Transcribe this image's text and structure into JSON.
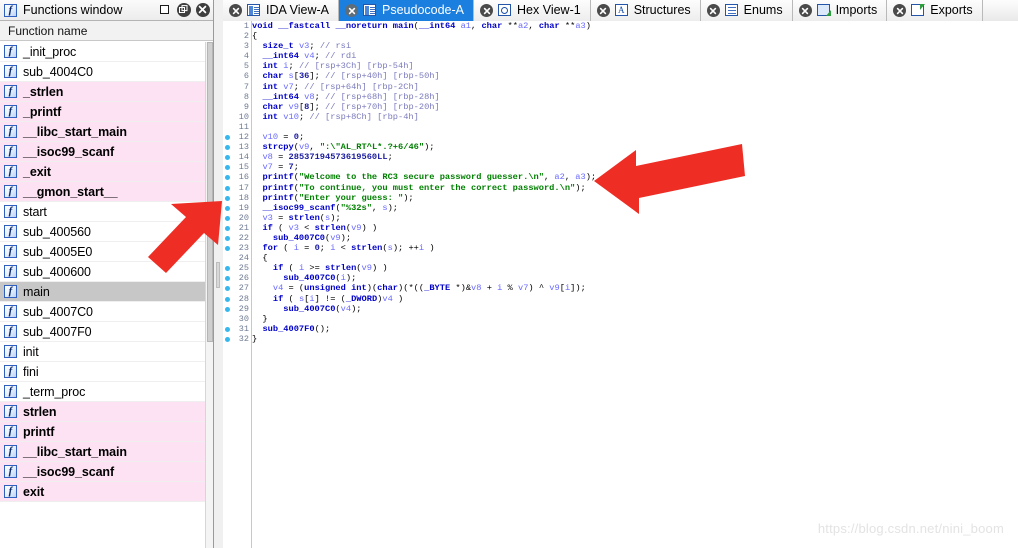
{
  "functions_window": {
    "title": "Functions window",
    "title_icon": "function-f-icon",
    "buttons": {
      "restore_label": "restore-window",
      "float_label": "float-window",
      "close_label": "close-window"
    },
    "column_header": "Function name",
    "rows": [
      {
        "name": "_init_proc",
        "style": "normal"
      },
      {
        "name": "sub_4004C0",
        "style": "normal"
      },
      {
        "name": "_strlen",
        "style": "pink"
      },
      {
        "name": "_printf",
        "style": "pink"
      },
      {
        "name": "__libc_start_main",
        "style": "pink"
      },
      {
        "name": "__isoc99_scanf",
        "style": "pink"
      },
      {
        "name": "_exit",
        "style": "pink"
      },
      {
        "name": "__gmon_start__",
        "style": "pink"
      },
      {
        "name": "start",
        "style": "normal"
      },
      {
        "name": "sub_400560",
        "style": "normal"
      },
      {
        "name": "sub_4005E0",
        "style": "normal"
      },
      {
        "name": "sub_400600",
        "style": "normal"
      },
      {
        "name": "main",
        "style": "selected"
      },
      {
        "name": "sub_4007C0",
        "style": "normal"
      },
      {
        "name": "sub_4007F0",
        "style": "normal"
      },
      {
        "name": "init",
        "style": "normal"
      },
      {
        "name": "fini",
        "style": "normal"
      },
      {
        "name": "_term_proc",
        "style": "normal"
      },
      {
        "name": "strlen",
        "style": "pink"
      },
      {
        "name": "printf",
        "style": "pink"
      },
      {
        "name": "__libc_start_main",
        "style": "pink"
      },
      {
        "name": "__isoc99_scanf",
        "style": "pink"
      },
      {
        "name": "exit",
        "style": "pink"
      }
    ]
  },
  "tabs": [
    {
      "label": "IDA View-A",
      "icon": "ida-view-icon",
      "active": false
    },
    {
      "label": "Pseudocode-A",
      "icon": "pseudocode-icon",
      "active": true
    },
    {
      "label": "Hex View-1",
      "icon": "hex-view-icon",
      "active": false
    },
    {
      "label": "Structures",
      "icon": "structures-icon",
      "active": false
    },
    {
      "label": "Enums",
      "icon": "enums-icon",
      "active": false
    },
    {
      "label": "Imports",
      "icon": "imports-icon",
      "active": false
    },
    {
      "label": "Exports",
      "icon": "exports-icon",
      "active": false
    }
  ],
  "pseudocode": {
    "marked_lines": [
      12,
      13,
      14,
      15,
      16,
      17,
      18,
      19,
      20,
      21,
      22,
      23,
      25,
      26,
      27,
      28,
      29,
      31,
      32
    ],
    "lines": [
      {
        "n": 1,
        "text": "void __fastcall __noreturn main(__int64 a1, char **a2, char **a3)"
      },
      {
        "n": 2,
        "text": "{"
      },
      {
        "n": 3,
        "text": "  size_t v3; // rsi"
      },
      {
        "n": 4,
        "text": "  __int64 v4; // rdi"
      },
      {
        "n": 5,
        "text": "  int i; // [rsp+3Ch] [rbp-54h]"
      },
      {
        "n": 6,
        "text": "  char s[36]; // [rsp+40h] [rbp-50h]"
      },
      {
        "n": 7,
        "text": "  int v7; // [rsp+64h] [rbp-2Ch]"
      },
      {
        "n": 8,
        "text": "  __int64 v8; // [rsp+68h] [rbp-28h]"
      },
      {
        "n": 9,
        "text": "  char v9[8]; // [rsp+70h] [rbp-20h]"
      },
      {
        "n": 10,
        "text": "  int v10; // [rsp+8Ch] [rbp-4h]"
      },
      {
        "n": 11,
        "text": ""
      },
      {
        "n": 12,
        "text": "  v10 = 0;"
      },
      {
        "n": 13,
        "text": "  strcpy(v9, \":\\\"AL_RT^L*.?+6/46\");"
      },
      {
        "n": 14,
        "text": "  v8 = 28537194573619560LL;"
      },
      {
        "n": 15,
        "text": "  v7 = 7;"
      },
      {
        "n": 16,
        "text": "  printf(\"Welcome to the RC3 secure password guesser.\\n\", a2, a3);"
      },
      {
        "n": 17,
        "text": "  printf(\"To continue, you must enter the correct password.\\n\");"
      },
      {
        "n": 18,
        "text": "  printf(\"Enter your guess: \");"
      },
      {
        "n": 19,
        "text": "  __isoc99_scanf(\"%32s\", s);"
      },
      {
        "n": 20,
        "text": "  v3 = strlen(s);"
      },
      {
        "n": 21,
        "text": "  if ( v3 < strlen(v9) )"
      },
      {
        "n": 22,
        "text": "    sub_4007C0(v9);"
      },
      {
        "n": 23,
        "text": "  for ( i = 0; i < strlen(s); ++i )"
      },
      {
        "n": 24,
        "text": "  {"
      },
      {
        "n": 25,
        "text": "    if ( i >= strlen(v9) )"
      },
      {
        "n": 26,
        "text": "      sub_4007C0(i);"
      },
      {
        "n": 27,
        "text": "    v4 = (unsigned int)(char)(*((_BYTE *)&v8 + i % v7) ^ v9[i]);"
      },
      {
        "n": 28,
        "text": "    if ( s[i] != (_DWORD)v4 )"
      },
      {
        "n": 29,
        "text": "      sub_4007C0(v4);"
      },
      {
        "n": 30,
        "text": "  }"
      },
      {
        "n": 31,
        "text": "  sub_4007F0();"
      },
      {
        "n": 32,
        "text": "}"
      }
    ]
  },
  "annotations": {
    "arrow_color": "#ee2d24",
    "arrow_sidebar_label": "red-arrow-pointing-to-sub_400600",
    "arrow_code_label": "red-arrow-pointing-to-printf-line"
  },
  "watermark": "https://blog.csdn.net/nini_boom",
  "colors": {
    "tab_active_bg": "#1b7fe0",
    "row_pink": "#fde2f4",
    "row_selected": "#c7c7c7",
    "gutter_dot": "#35b7ef",
    "keyword": "#0000c8",
    "string": "#008000",
    "variable": "#6a6aff",
    "comment": "#7b7bbd"
  }
}
